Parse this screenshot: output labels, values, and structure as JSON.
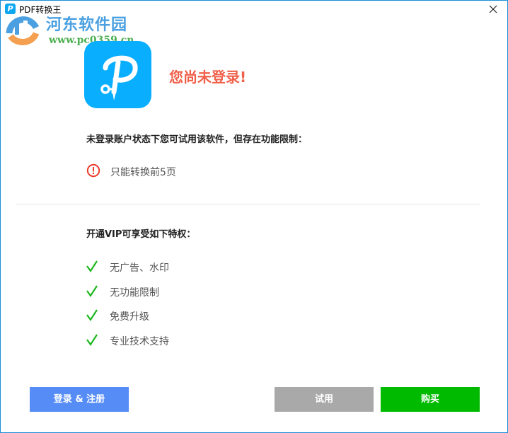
{
  "window": {
    "title": "PDF转换王",
    "app_icon_glyph": "P",
    "close_icon": "close-icon"
  },
  "watermark": {
    "name": "河东软件园",
    "url": "www.pc0359.cn"
  },
  "headline": "您尚未登录!",
  "limitation": {
    "title": "未登录账户状态下您可试用该软件，但存在功能限制：",
    "items": [
      {
        "icon": "warning-circle-icon",
        "text": "只能转换前5页"
      }
    ]
  },
  "vip": {
    "title": "开通VIP可享受如下特权：",
    "features": [
      {
        "icon": "check-icon",
        "text": "无广告、水印"
      },
      {
        "icon": "check-icon",
        "text": "无功能限制"
      },
      {
        "icon": "check-icon",
        "text": "免费升级"
      },
      {
        "icon": "check-icon",
        "text": "专业技术支持"
      }
    ]
  },
  "buttons": {
    "login": "登录 & 注册",
    "trial": "试用",
    "buy": "购买"
  },
  "colors": {
    "accent_blue": "#0aaeff",
    "headline_red": "#f0604a",
    "check_green": "#1cb81c",
    "login_blue": "#568cf6",
    "trial_gray": "#a9a9a9",
    "buy_green": "#00ba00",
    "border_blue": "#1a8fd8"
  }
}
